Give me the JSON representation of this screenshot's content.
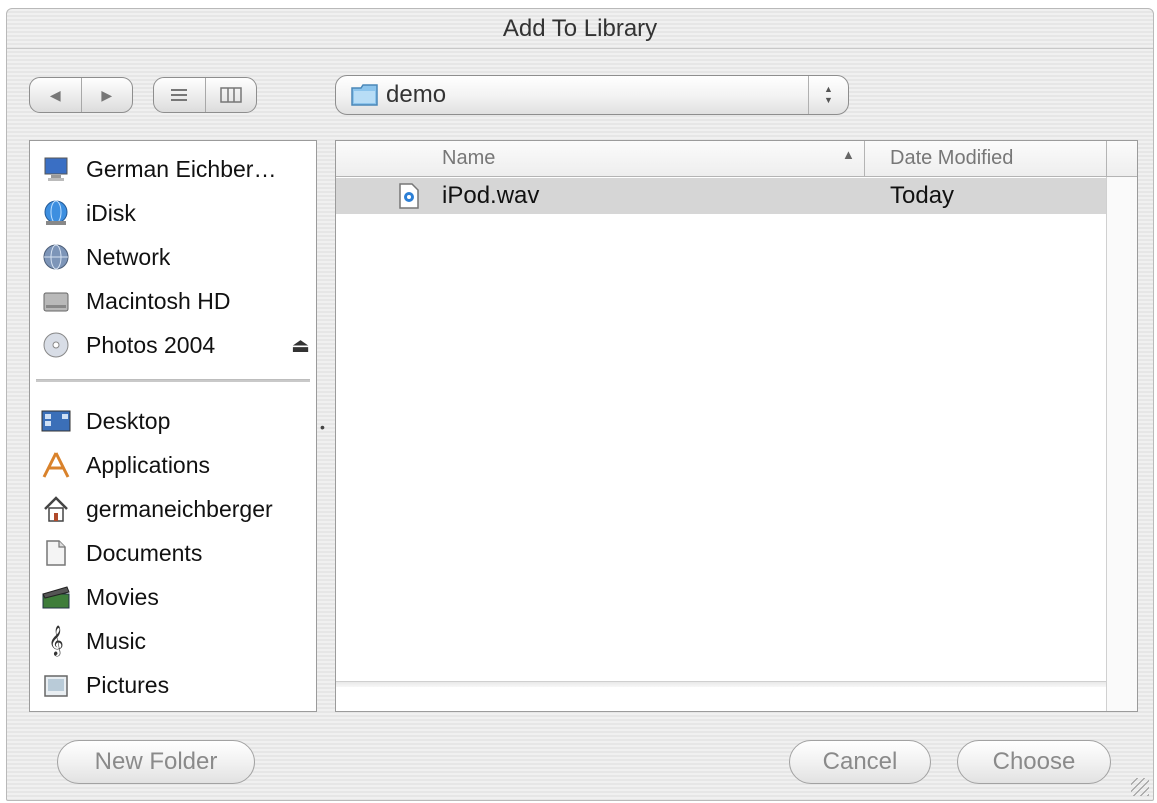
{
  "window": {
    "title": "Add To Library"
  },
  "toolbar": {
    "back_icon": "back-arrow-icon",
    "forward_icon": "forward-arrow-icon",
    "list_view_icon": "list-view-icon",
    "column_view_icon": "column-view-icon",
    "path": {
      "label": "demo",
      "icon": "folder-icon"
    }
  },
  "sidebar": {
    "devices": [
      {
        "label": "German Eichber…",
        "icon": "computer-icon"
      },
      {
        "label": "iDisk",
        "icon": "idisk-icon"
      },
      {
        "label": "Network",
        "icon": "network-globe-icon"
      },
      {
        "label": "Macintosh HD",
        "icon": "hard-drive-icon"
      },
      {
        "label": "Photos 2004",
        "icon": "cd-disc-icon",
        "eject": "⏏"
      }
    ],
    "places": [
      {
        "label": "Desktop",
        "icon": "desktop-icon"
      },
      {
        "label": "Applications",
        "icon": "applications-icon"
      },
      {
        "label": "germaneichberger",
        "icon": "home-icon"
      },
      {
        "label": "Documents",
        "icon": "documents-icon"
      },
      {
        "label": "Movies",
        "icon": "movies-clapper-icon"
      },
      {
        "label": "Music",
        "icon": "music-clef-icon"
      },
      {
        "label": "Pictures",
        "icon": "pictures-icon"
      }
    ]
  },
  "file_list": {
    "columns": {
      "name": "Name",
      "date": "Date Modified"
    },
    "rows": [
      {
        "name": "iPod.wav",
        "date": "Today",
        "icon": "audio-file-icon"
      }
    ]
  },
  "buttons": {
    "new_folder": "New Folder",
    "cancel": "Cancel",
    "choose": "Choose"
  },
  "colors": {
    "selection_row": "#d6d6d6",
    "border": "#9b9b9b",
    "disabled_text": "#8a8a8a"
  }
}
